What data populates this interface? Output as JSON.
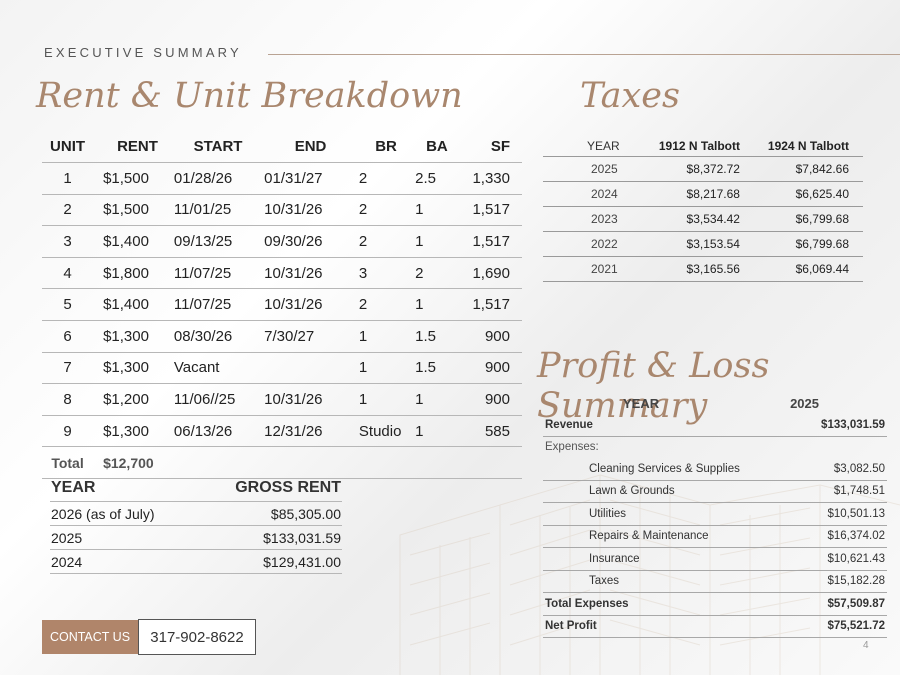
{
  "section_label": "EXECUTIVE SUMMARY",
  "titles": {
    "rent": "Rent & Unit Breakdown",
    "taxes": "Taxes",
    "pl": "Profit & Loss Summary"
  },
  "units": {
    "headers": [
      "UNIT",
      "RENT",
      "START",
      "END",
      "BR",
      "BA",
      "SF"
    ],
    "rows": [
      [
        "1",
        "$1,500",
        "01/28/26",
        "01/31/27",
        "2",
        "2.5",
        "1,330"
      ],
      [
        "2",
        "$1,500",
        "11/01/25",
        "10/31/26",
        "2",
        "1",
        "1,517"
      ],
      [
        "3",
        "$1,400",
        "09/13/25",
        "09/30/26",
        "2",
        "1",
        "1,517"
      ],
      [
        "4",
        "$1,800",
        "11/07/25",
        "10/31/26",
        "3",
        "2",
        "1,690"
      ],
      [
        "5",
        "$1,400",
        "11/07/25",
        "10/31/26",
        "2",
        "1",
        "1,517"
      ],
      [
        "6",
        "$1,300",
        "08/30/26",
        "7/30/27",
        "1",
        "1.5",
        "900"
      ],
      [
        "7",
        "$1,300",
        "Vacant",
        "",
        "1",
        "1.5",
        "900"
      ],
      [
        "8",
        "$1,200",
        "11/06//25",
        "10/31/26",
        "1",
        "1",
        "900"
      ],
      [
        "9",
        "$1,300",
        "06/13/26",
        "12/31/26",
        "Studio",
        "1",
        "585"
      ]
    ],
    "total_label": "Total",
    "total_rent": "$12,700"
  },
  "gross_rent": {
    "headers": [
      "YEAR",
      "GROSS RENT"
    ],
    "rows": [
      [
        "2026 (as of July)",
        "$85,305.00"
      ],
      [
        "2025",
        "$133,031.59"
      ],
      [
        "2024",
        "$129,431.00"
      ]
    ]
  },
  "taxes": {
    "headers": [
      "YEAR",
      "1912 N Talbott",
      "1924 N Talbott"
    ],
    "rows": [
      [
        "2025",
        "$8,372.72",
        "$7,842.66"
      ],
      [
        "2024",
        "$8,217.68",
        "$6,625.40"
      ],
      [
        "2023",
        "$3,534.42",
        "$6,799.68"
      ],
      [
        "2022",
        "$3,153.54",
        "$6,799.68"
      ],
      [
        "2021",
        "$3,165.56",
        "$6,069.44"
      ]
    ]
  },
  "pl": {
    "headers": [
      "YEAR",
      "2025"
    ],
    "revenue_label": "Revenue",
    "revenue_value": "$133,031.59",
    "expenses_label": "Expenses:",
    "expenses": [
      [
        "Cleaning Services & Supplies",
        "$3,082.50"
      ],
      [
        "Lawn & Grounds",
        "$1,748.51"
      ],
      [
        "Utilities",
        "$10,501.13"
      ],
      [
        "Repairs & Maintenance",
        "$16,374.02"
      ],
      [
        "Insurance",
        "$10,621.43"
      ],
      [
        "Taxes",
        "$15,182.28"
      ]
    ],
    "total_expenses_label": "Total Expenses",
    "total_expenses_value": "$57,509.87",
    "net_profit_label": "Net Profit",
    "net_profit_value": "$75,521.72"
  },
  "contact": {
    "button_label": "CONTACT US",
    "phone": "317-902-8622"
  },
  "page_number": "4"
}
